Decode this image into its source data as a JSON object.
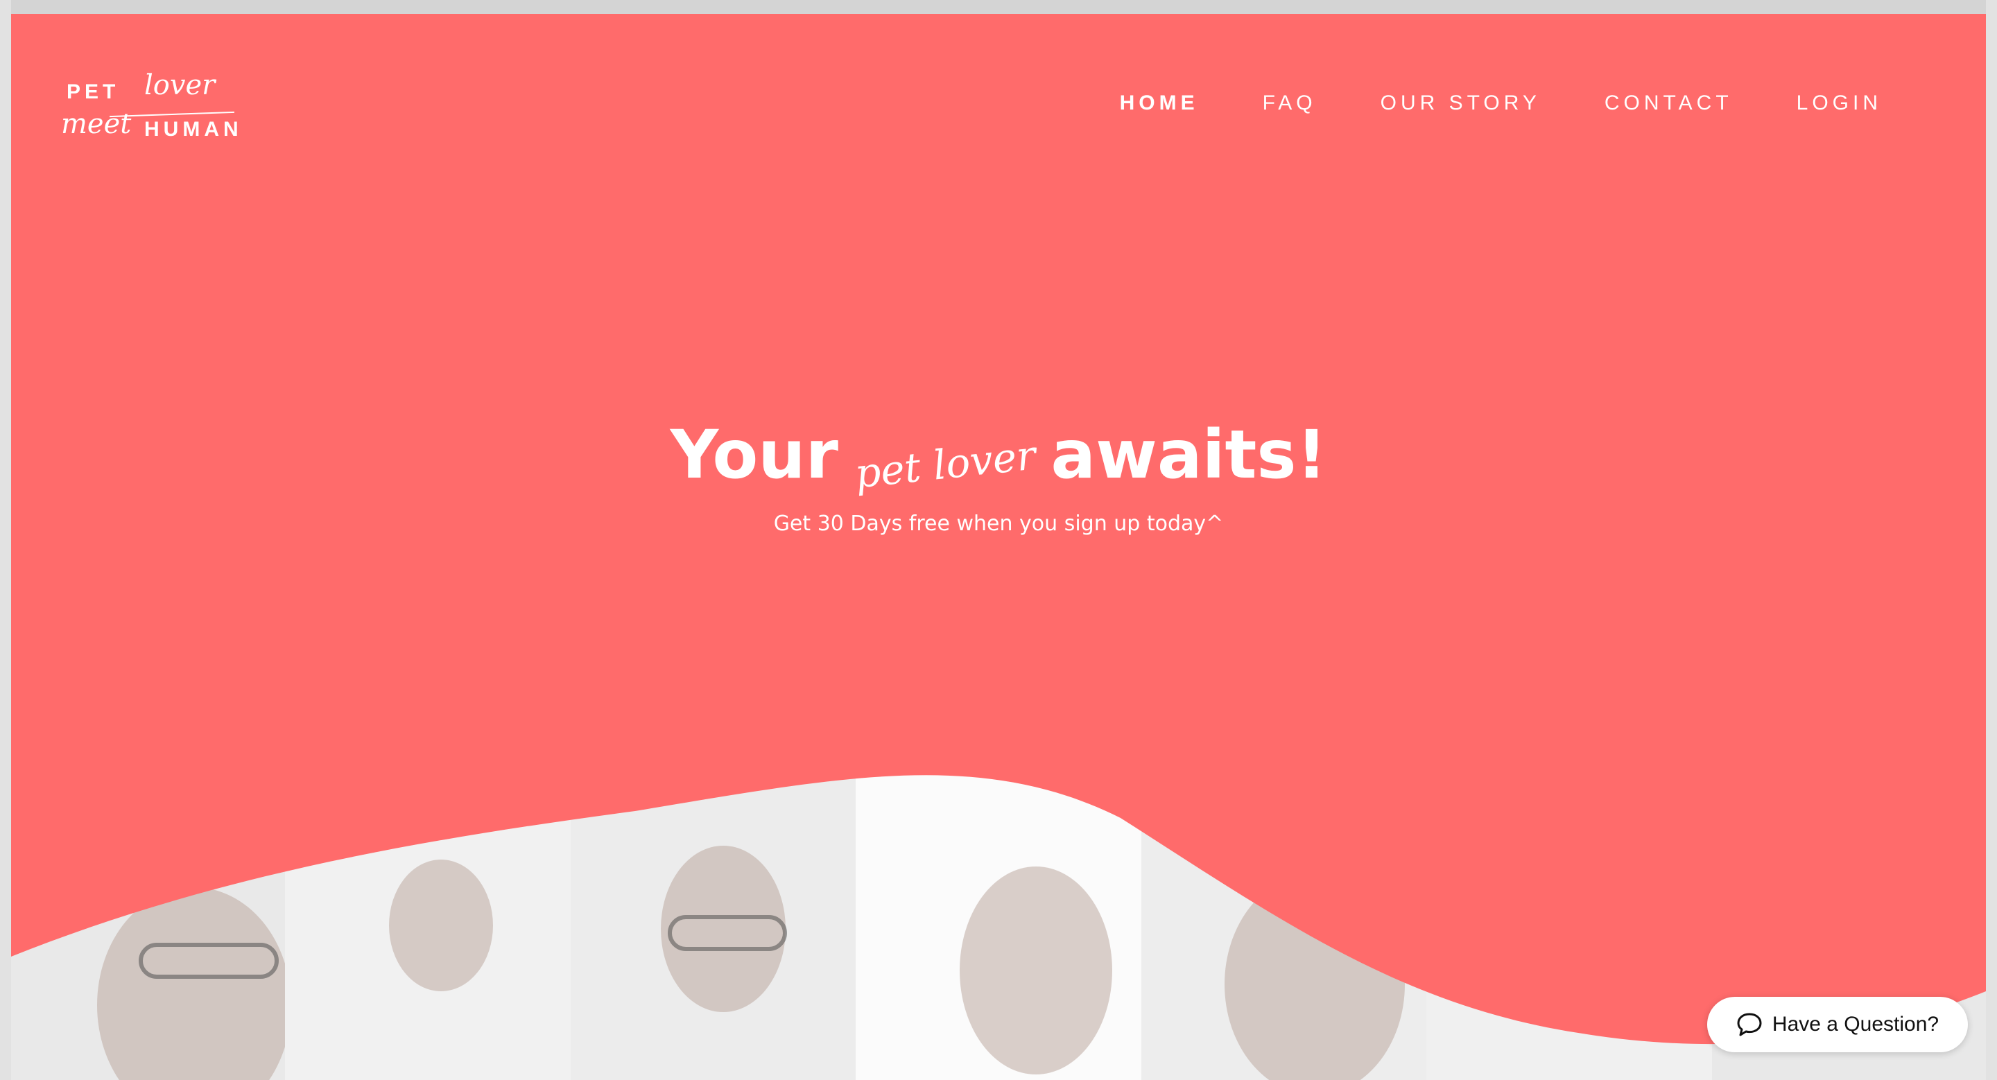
{
  "colors": {
    "hero": "#ff6b6b",
    "text": "#ffffff",
    "chat_bg": "#ffffff"
  },
  "brand": {
    "logo_pet": "PET",
    "logo_lover": "lover",
    "logo_meet": "meet",
    "logo_human": "HUMAN"
  },
  "nav": {
    "items": [
      {
        "label": "HOME",
        "active": true
      },
      {
        "label": "FAQ",
        "active": false
      },
      {
        "label": "OUR STORY",
        "active": false
      },
      {
        "label": "CONTACT",
        "active": false
      },
      {
        "label": "LOGIN",
        "active": false
      }
    ]
  },
  "hero": {
    "headline_start": "Your",
    "headline_script": "pet lover",
    "headline_end": "awaits!",
    "subline": "Get 30 Days free when you sign up today^"
  },
  "chat": {
    "label": "Have a Question?",
    "icon": "speech-bubble-icon"
  }
}
